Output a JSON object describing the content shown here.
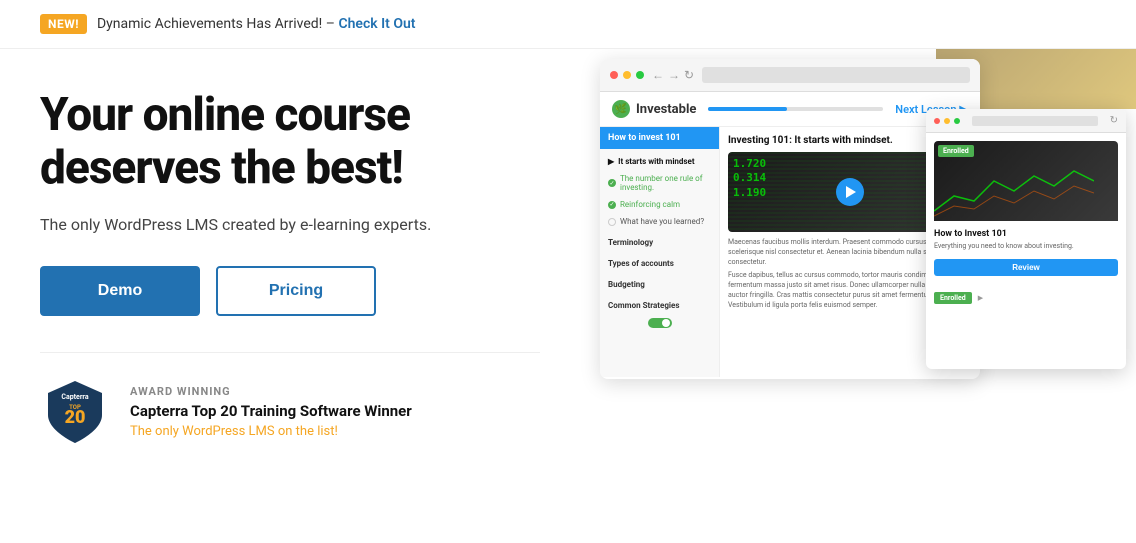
{
  "announcement": {
    "badge": "NEW!",
    "text": "Dynamic Achievements Has Arrived! –",
    "link_text": "Check It Out",
    "link_href": "#"
  },
  "hero": {
    "title": "Your online course deserves the best!",
    "subtitle": "The only WordPress LMS created by e-learning experts.",
    "demo_button": "Demo",
    "pricing_button": "Pricing"
  },
  "award": {
    "label": "AWARD WINNING",
    "title": "Capterra Top 20 Training Software Winner",
    "subtitle": "The only WordPress LMS on the list!"
  },
  "browser_mockup": {
    "logo_name": "Investable",
    "next_lesson": "Next Lesson",
    "course_header": "How to invest 101",
    "lesson_title": "It starts with mindset",
    "sidebar_items": [
      {
        "label": "It starts with mindset",
        "status": "active"
      },
      {
        "label": "The number one rule of investing.",
        "status": "completed"
      },
      {
        "label": "Reinforcing calm",
        "status": "completed"
      },
      {
        "label": "What have you learned?",
        "status": "empty"
      },
      {
        "label": "Terminology",
        "status": "section"
      },
      {
        "label": "Types of accounts",
        "status": "section"
      },
      {
        "label": "Budgeting",
        "status": "section"
      },
      {
        "label": "Common Strategies",
        "status": "section"
      }
    ],
    "main_title": "Investing 101: It starts with mindset.",
    "description": "Maecenas faucibus mollis interdum. Praesent commodo cursus magna, vel scelerisque nisl consectetur et. Aenean lacinia bibendum nulla sed consectetur.",
    "description2": "Fusce dapibus, tellus ac cursus commodo, tortor mauris condimentum nibh, ut fermentum massa justo sit amet risus. Donec ullamcorper nulla non metus auctor fringilla. Cras mattis consectetur purus sit amet fermentum. Vestibulum id ligula porta felis euismod semper."
  },
  "browser_mockup_2": {
    "course_title": "How to Invest 101",
    "course_description": "Everything you need to know about investing.",
    "review_button": "Review",
    "enrolled_label": "Enrolled"
  },
  "colors": {
    "primary_blue": "#2196f3",
    "primary_dark": "#2271b1",
    "orange": "#f5a623",
    "green": "#4caf50"
  }
}
